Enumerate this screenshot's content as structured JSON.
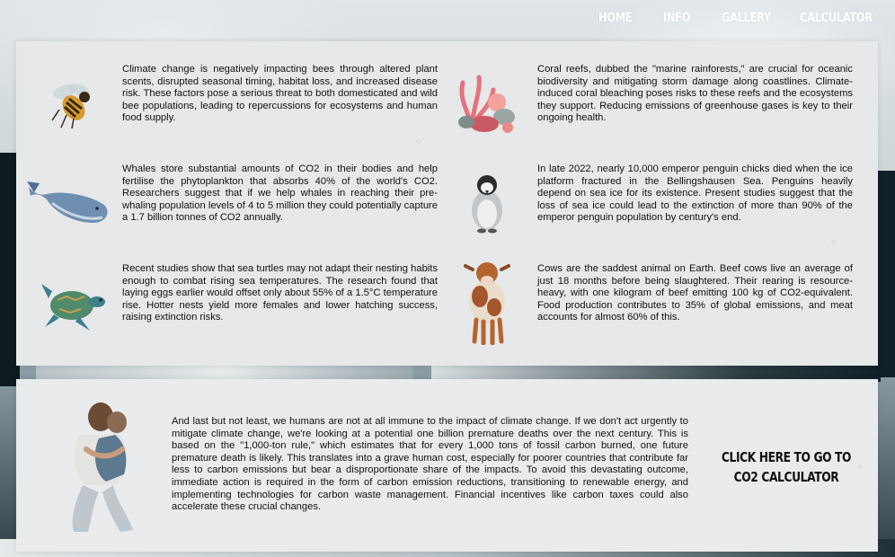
{
  "nav": {
    "items": [
      {
        "label": "HOME"
      },
      {
        "label": "INFO"
      },
      {
        "label": "GALLERY"
      },
      {
        "label": "CALCULATOR"
      }
    ]
  },
  "cards": {
    "bees": {
      "icon": "bee-icon",
      "text": "Climate change is negatively impacting bees through altered plant scents, disrupted seasonal timing, habitat loss, and increased disease risk. These factors pose a serious threat to both domesticated and wild bee populations, leading to repercussions for ecosystems and human food supply."
    },
    "coral": {
      "icon": "coral-icon",
      "text": "Coral reefs, dubbed the \"marine rainforests,\" are crucial for oceanic biodiversity and mitigating storm damage along coastlines. Climate-induced coral bleaching poses risks to these reefs and the ecosystems they support. Reducing emissions of greenhouse gases is key to their ongoing health."
    },
    "whales": {
      "icon": "whale-icon",
      "text": "Whales store substantial amounts of CO2 in their bodies and help fertilise the phytoplankton that absorbs 40% of the world's CO2. Researchers suggest that if we help whales in reaching their pre-whaling population levels of 4 to 5 million they could potentially capture a 1.7 billion tonnes of CO2 annually."
    },
    "penguins": {
      "icon": "penguin-icon",
      "text": "In late 2022, nearly 10,000 emperor penguin chicks died when the ice platform fractured in the Bellingshausen Sea. Penguins heavily depend on sea ice for its existence. Present studies suggest that the loss of sea ice could lead to the extinction of more than 90% of the emperor penguin population by century's end."
    },
    "turtles": {
      "icon": "sea-turtle-icon",
      "text": "Recent studies show that sea turtles may not adapt their nesting habits enough to combat rising sea temperatures. The research found that laying eggs earlier would offset only about 55% of a 1.5°C temperature rise. Hotter nests yield more females and lower hatching success, raising extinction risks."
    },
    "cows": {
      "icon": "cow-icon",
      "text": "Cows are the saddest animal on Earth. Beef cows live an average of just 18 months before being slaughtered. Their rearing is resource-heavy, with one kilogram of beef emitting 100 kg of CO2-equivalent. Food production contributes to 35% of global emissions, and meat accounts for almost 60% of this."
    }
  },
  "humans": {
    "icon": "father-child-hug-icon",
    "text": "And last but not least, we humans are not at all immune to the impact of climate change. If we don't act urgently to mitigate climate change, we're looking at a potential one billion premature deaths over the next century. This is based on the \"1,000-ton rule,\" which estimates that for every 1,000 tons of fossil carbon burned, one future premature death is likely. This translates into a grave human cost, especially for poorer countries that contribute far less to carbon emissions but bear a disproportionate share of the impacts. To avoid this devastating outcome, immediate action is required in the form of carbon emission reductions, transitioning to renewable energy, and implementing technologies for carbon waste management. Financial incentives like carbon taxes could also accelerate these crucial changes."
  },
  "cta": {
    "label": "CLICK HERE TO GO TO CO2 CALCULATOR"
  }
}
